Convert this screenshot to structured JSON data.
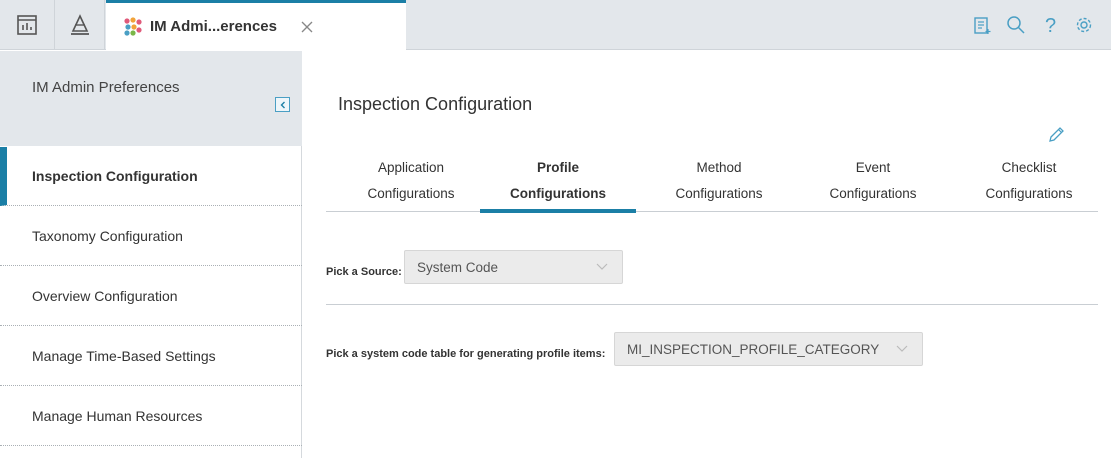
{
  "topbar": {
    "tab_title": "IM Admi...erences",
    "icons": [
      "dashboard-icon",
      "asset-hierarchy-icon",
      "admin-module-icon",
      "close-icon",
      "clipboard-icon",
      "search-icon",
      "help-icon",
      "gear-icon"
    ]
  },
  "sidebar": {
    "title": "IM Admin Preferences",
    "items": [
      {
        "label": "Inspection Configuration"
      },
      {
        "label": "Taxonomy Configuration"
      },
      {
        "label": "Overview Configuration"
      },
      {
        "label": "Manage Time-Based Settings"
      },
      {
        "label": "Manage Human Resources"
      }
    ]
  },
  "main": {
    "title": "Inspection Configuration",
    "tabs": [
      {
        "line1": "Application",
        "line2": "Configurations"
      },
      {
        "line1": "Profile",
        "line2": "Configurations"
      },
      {
        "line1": "Method",
        "line2": "Configurations"
      },
      {
        "line1": "Event",
        "line2": "Configurations"
      },
      {
        "line1": "Checklist",
        "line2": "Configurations"
      }
    ],
    "source_label": "Pick a Source:",
    "source_value": "System Code",
    "table_label": "Pick a system code table for generating profile items:",
    "table_value": "MI_INSPECTION_PROFILE_CATEGORY"
  },
  "colors": {
    "accent": "#1b7fa6",
    "topbar_bg": "#e3e7eb"
  }
}
